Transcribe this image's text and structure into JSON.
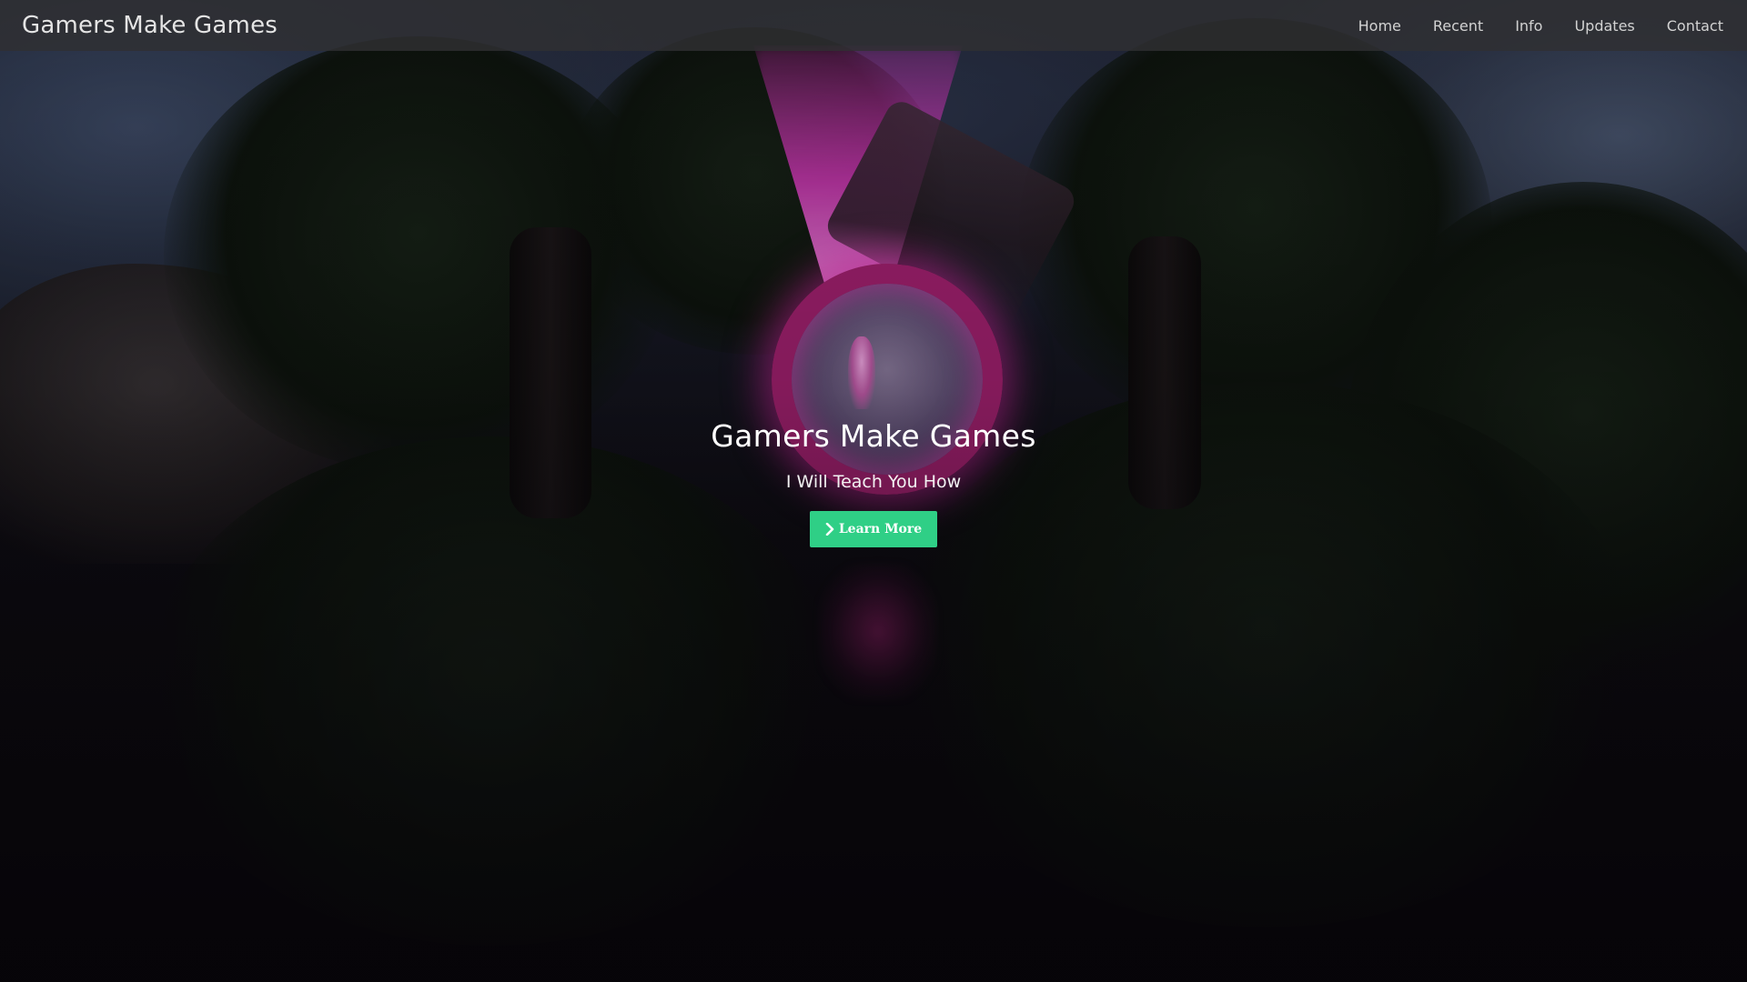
{
  "navbar": {
    "brand": "Gamers Make Games",
    "links": [
      {
        "label": "Home"
      },
      {
        "label": "Recent"
      },
      {
        "label": "Info"
      },
      {
        "label": "Updates"
      },
      {
        "label": "Contact"
      }
    ]
  },
  "hero": {
    "title": "Gamers Make Games",
    "subtitle": "I Will Teach You How",
    "button": {
      "label": "Learn More",
      "icon": "chevron-right-icon",
      "color": "#2fcf86"
    }
  },
  "colors": {
    "navbar_bg": "#303032",
    "accent": "#2fcf86",
    "portal_glow": "#e030c0"
  }
}
